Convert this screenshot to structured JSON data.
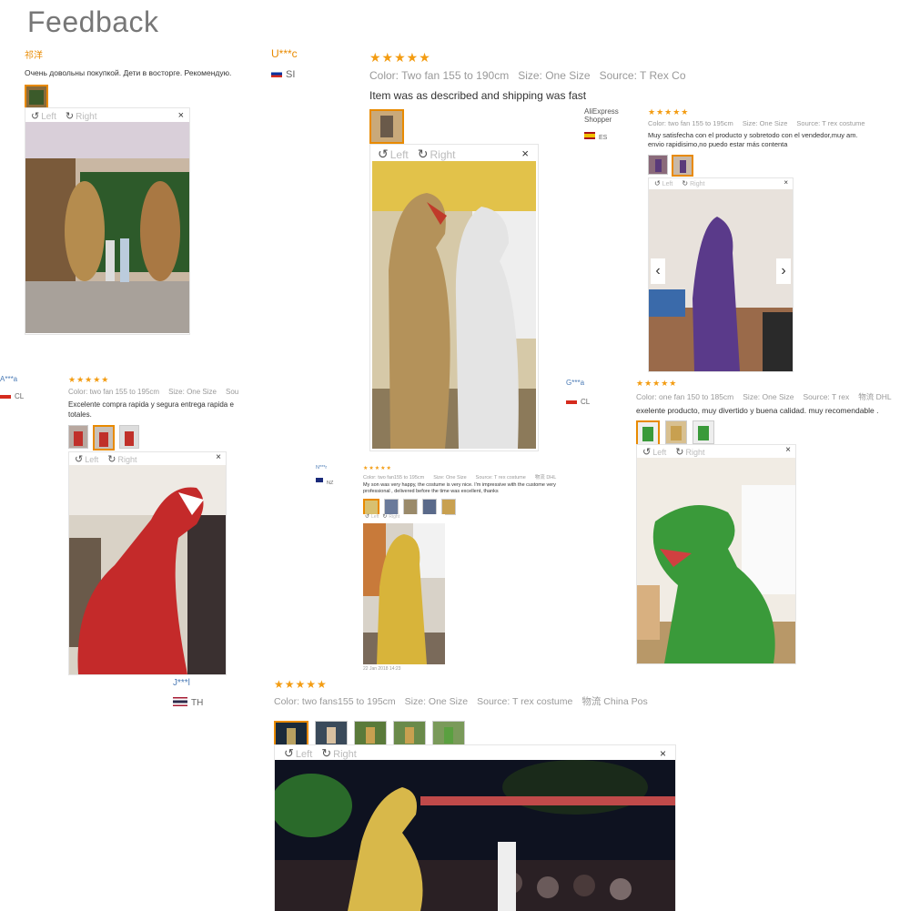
{
  "page": {
    "title": "Feedback"
  },
  "reviews": [
    {
      "id": "r1",
      "name": "祁洋",
      "text": "Очень довольны покупкой. Дети в восторге. Рекомендую.",
      "nav_left": "Left",
      "nav_right": "Right",
      "close": "×"
    },
    {
      "id": "r2",
      "name": "U***c",
      "country": "SI",
      "stars": "★★★★★",
      "color": "Color: Two fan 155 to 190cm",
      "size": "Size: One Size",
      "source": "Source: T Rex Co",
      "text": "Item was as described and shipping was fast",
      "nav_left": "Left",
      "nav_right": "Right",
      "close": "×"
    },
    {
      "id": "r3",
      "name": "AliExpress Shopper",
      "country": "ES",
      "stars": "★★★★★",
      "color": "Color: two fan 155 to 195cm",
      "size": "Size: One Size",
      "source": "Source: T rex costume",
      "text": "Muy satisfecha con el producto y sobretodo con el vendedor,muy am. envio rapidisimo,no puedo estar más contenta",
      "nav_left": "Left",
      "nav_right": "Right",
      "close": "×",
      "prev": "‹",
      "next": "›"
    },
    {
      "id": "r4",
      "name": "A***a",
      "country": "CL",
      "stars": "★★★★★",
      "color": "Color: two fan 155 to 195cm",
      "size": "Size: One Size",
      "source": "Sou",
      "text": "Excelente compra rapida y segura entrega rapida e totales.",
      "nav_left": "Left",
      "nav_right": "Right",
      "close": "×"
    },
    {
      "id": "r5",
      "name": "G***a",
      "country": "CL",
      "stars": "★★★★★",
      "color": "Color: one fan 150 to 185cm",
      "size": "Size: One Size",
      "source": "Source: T rex",
      "shipping": "物流 DHL",
      "text": "exelente producto, muy divertido y buena calidad. muy recomendable .",
      "nav_left": "Left",
      "nav_right": "Right",
      "close": "×"
    },
    {
      "id": "r6",
      "name": "N***r",
      "country": "NZ",
      "stars": "★★★★★",
      "color": "Color: two fan155 to 195cm",
      "size": "Size: One Size",
      "source": "Source: T rex costume",
      "shipping": "物流 DHL",
      "text": "My son was very happy, the costume is very nice. I'm impressive with the custome very professional , delivered before the time was excellent, thanks",
      "date": "22 Jan 2018 14:23",
      "nav_left": "Left",
      "nav_right": "Right"
    },
    {
      "id": "r7",
      "name": "J***l",
      "country": "TH",
      "stars": "★★★★★",
      "color": "Color: two fans155 to 195cm",
      "size": "Size: One Size",
      "source": "Source: T rex costume",
      "shipping": "物流 China Pos",
      "nav_left": "Left",
      "nav_right": "Right",
      "close": "×"
    }
  ],
  "colors": {
    "accent": "#e88a00",
    "stars": "#f39c12"
  }
}
